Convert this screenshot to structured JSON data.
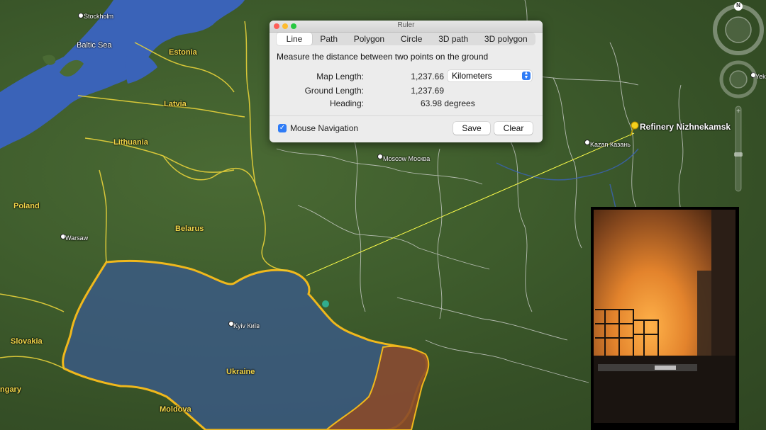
{
  "map": {
    "places": [
      {
        "id": "stockholm",
        "text": "Stockholm"
      },
      {
        "id": "baltic-sea",
        "text": "Baltic Sea"
      },
      {
        "id": "estonia",
        "text": "Estonia"
      },
      {
        "id": "latvia",
        "text": "Latvia"
      },
      {
        "id": "lithuania",
        "text": "Lithuania"
      },
      {
        "id": "poland",
        "text": "Poland"
      },
      {
        "id": "belarus",
        "text": "Belarus"
      },
      {
        "id": "warsaw",
        "text": "Warsaw"
      },
      {
        "id": "moscow",
        "text": "Moscow Москва"
      },
      {
        "id": "kazan",
        "text": "Kazan Казань"
      },
      {
        "id": "refinery",
        "text": "Refinery Nizhnekamsk"
      },
      {
        "id": "kyiv",
        "text": "Kyiv Київ"
      },
      {
        "id": "ukraine",
        "text": "Ukraine"
      },
      {
        "id": "slovakia",
        "text": "Slovakia"
      },
      {
        "id": "hungary",
        "text": "ngary"
      },
      {
        "id": "moldova",
        "text": "Moldova"
      },
      {
        "id": "yek",
        "text": "Yek"
      }
    ],
    "colors": {
      "ukraine_fill": "#3b5a86",
      "occupied_fill": "#8a4a2a",
      "ukraine_border": "#f0b81c",
      "ruler_line": "#ffff4a",
      "water": "#3a63b8"
    }
  },
  "ruler": {
    "title": "Ruler",
    "tabs": [
      "Line",
      "Path",
      "Polygon",
      "Circle",
      "3D path",
      "3D polygon"
    ],
    "active_tab": "Line",
    "description": "Measure the distance between two points on the ground",
    "map_length_label": "Map Length:",
    "map_length_value": "1,237.66",
    "unit": "Kilometers",
    "ground_length_label": "Ground Length:",
    "ground_length_value": "1,237.69",
    "heading_label": "Heading:",
    "heading_value": "63.98 degrees",
    "mouse_nav_label": "Mouse Navigation",
    "mouse_nav_checked": true,
    "save_label": "Save",
    "clear_label": "Clear"
  },
  "nav": {
    "north_label": "N"
  }
}
